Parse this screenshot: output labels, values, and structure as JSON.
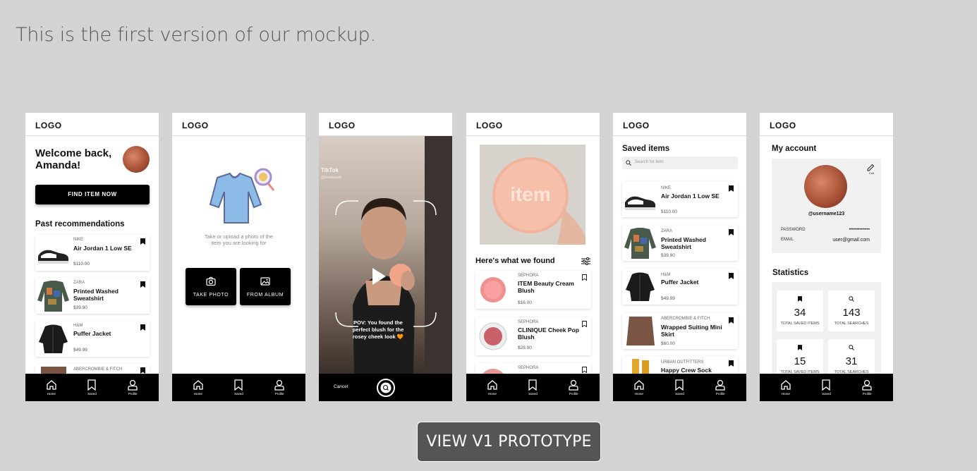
{
  "intro": "This is the first version of our mockup.",
  "logo": "LOGO",
  "nav": {
    "home": "Home",
    "saved": "Saved",
    "profile": "Profile"
  },
  "screen1": {
    "welcome": "Welcome back, Amanda!",
    "find_button": "FIND ITEM NOW",
    "section_title": "Past recommendations",
    "items": [
      {
        "brand": "NIKE",
        "name": "Air Jordan 1 Low SE",
        "price": "$110.00"
      },
      {
        "brand": "ZARA",
        "name": "Printed Washed Sweatshirt",
        "price": "$39.90"
      },
      {
        "brand": "H&M",
        "name": "Puffer Jacket",
        "price": "$49.99"
      },
      {
        "brand": "ABERCROMBIE & FITCH",
        "name": "",
        "price": ""
      }
    ]
  },
  "screen2": {
    "hint": "Take or upload a photo of the item you are looking for",
    "take_photo": "TAKE PHOTO",
    "from_album": "FROM ALBUM"
  },
  "screen3": {
    "tiktok": "TikTok",
    "handle": "@itembeauty",
    "caption": "POV: You found the perfect blush for the rosey cheek look 🧡",
    "cancel": "Cancel"
  },
  "screen4": {
    "section_title": "Here's what we found",
    "results": [
      {
        "brand": "SEPHORA",
        "name": "ITEM Beauty Cream Blush",
        "price": "$16.00"
      },
      {
        "brand": "SEPHORA",
        "name": "CLINIQUE Cheek Pop Blush",
        "price": "$28.00"
      },
      {
        "brand": "SEPHORA",
        "name": "",
        "price": ""
      }
    ]
  },
  "screen5": {
    "title": "Saved items",
    "search_placeholder": "Search for item",
    "items": [
      {
        "brand": "NIKE",
        "name": "Air Jordan 1 Low SE",
        "price": "$110.00"
      },
      {
        "brand": "ZARA",
        "name": "Printed Washed Sweatshirt",
        "price": "$39.90"
      },
      {
        "brand": "H&M",
        "name": "Puffer Jacket",
        "price": "$49.99"
      },
      {
        "brand": "ABERCROMBIE & FITCH",
        "name": "Wrapped Suiting Mini Skirt",
        "price": "$60.00"
      },
      {
        "brand": "URBAN OUTFITTERS",
        "name": "Happy Crew Sock",
        "price": ""
      }
    ]
  },
  "screen6": {
    "title": "My account",
    "edit": "Edit",
    "username": "@username123",
    "password_label": "PASSWORD",
    "password_value": "••••••••••••••",
    "email_label": "EMAIL",
    "email_value": "user@gmail.com",
    "stats_title": "Statistics",
    "stats": [
      {
        "value": "34",
        "label": "TOTAL SAVED ITEMS"
      },
      {
        "value": "143",
        "label": "TOTAL SEARCHES"
      },
      {
        "value": "15",
        "label": "TOTAL SAVED ITEMS"
      },
      {
        "value": "31",
        "label": "TOTAL SEARCHES"
      }
    ]
  },
  "prototype_button": "VIEW V1 PROTOTYPE"
}
